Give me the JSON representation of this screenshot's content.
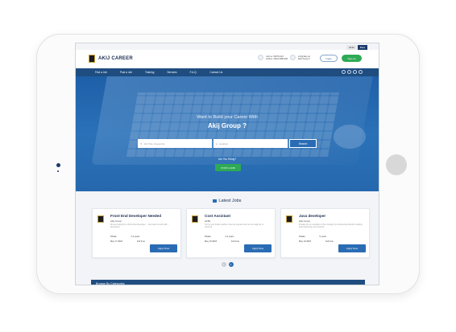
{
  "lang": [
    "ENG",
    "Beta"
  ],
  "brand": "AKIJ CAREER",
  "contact": [
    {
      "icon": "phone-icon",
      "line1": "Call us: 09678-222",
      "line2": "Hotline: 09613-888-999"
    },
    {
      "icon": "mail-icon",
      "line1": "info@akij.net",
      "line2": "Mail Support"
    }
  ],
  "auth": {
    "login": "Login",
    "signup": "Sign up"
  },
  "nav": [
    "Find a Job",
    "Post a Job",
    "Training",
    "Services",
    "F.A.Q.",
    "Contact Us"
  ],
  "social": [
    "facebook-icon",
    "twitter-icon",
    "linkedin-icon",
    "google-icon"
  ],
  "hero": {
    "subtitle": "Want to Build your Career With",
    "title": "Akij Group ?",
    "search_placeholder": "Job Title, Keywords",
    "location_placeholder": "Location",
    "search_button": "Search",
    "hiring": "Are You Hiring?",
    "post_job": "POST A JOB"
  },
  "latest_title": "Latest Jobs",
  "jobs": [
    {
      "title": "Front End Developer Needed",
      "company": "Akij Group",
      "desc": "We are looking for a Front End developer ... who want to work with ... developers",
      "location": "Dhaka",
      "experience": "2-3 years",
      "date": "May 17 2018",
      "type": "Full time",
      "apply": "Apply Now"
    },
    {
      "title": "Cost Assistant",
      "company": "AFBL",
      "desc": "Tell us your dream position: here we prepare that, Are we beginner or expert at",
      "location": "Dhaka",
      "experience": "2-3 years",
      "date": "May 15 2018",
      "type": "Full time",
      "apply": "Apply Now"
    },
    {
      "title": "Java developer",
      "company": "Akij Group",
      "desc": "Prepare for an a position in this company by constructing effective building and positioning your business",
      "location": "Dhaka",
      "experience": "5 years",
      "date": "May 19 2018",
      "type": "Full time",
      "apply": "Apply Now"
    }
  ],
  "pager": [
    "1",
    "2"
  ],
  "browse": "Browse By Categories"
}
